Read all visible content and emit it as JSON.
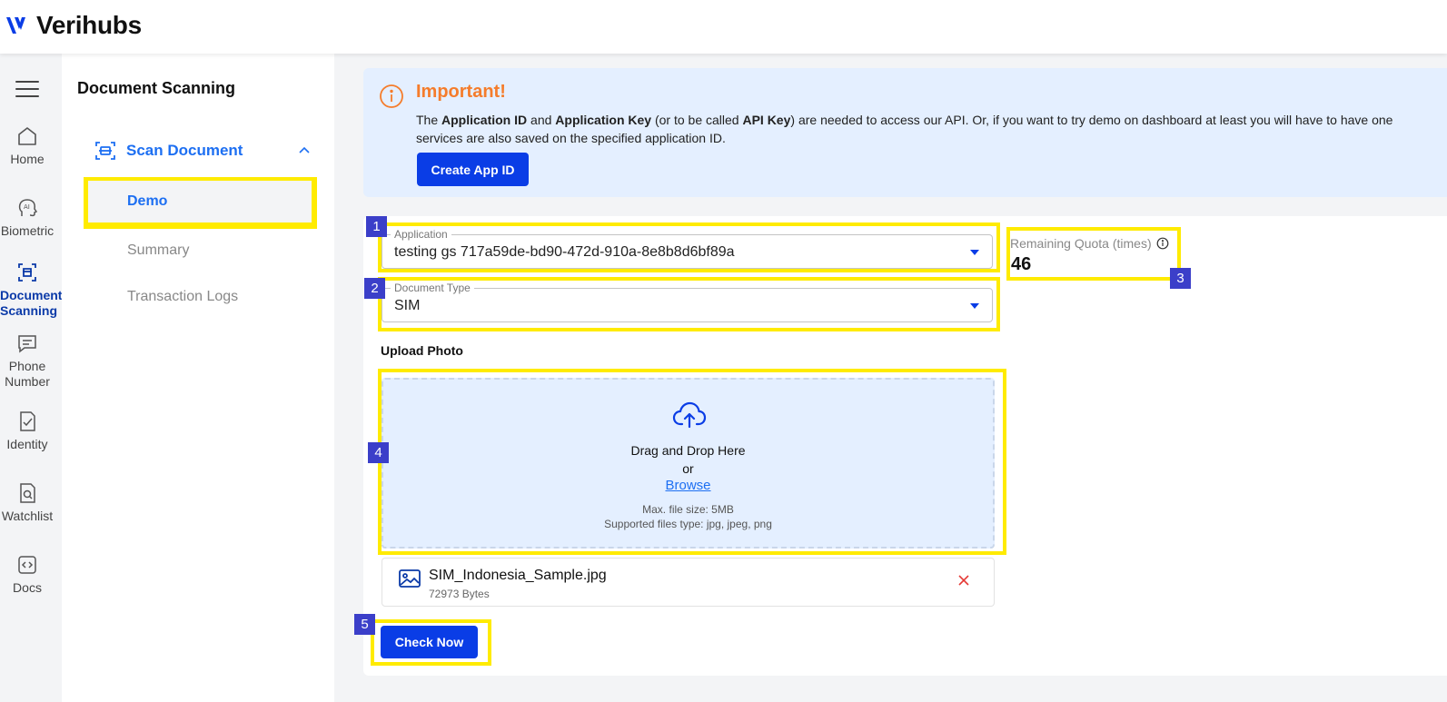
{
  "brand": {
    "name": "Verihubs"
  },
  "rail": {
    "items": [
      {
        "label_lines": [
          "Home"
        ],
        "icon": "home-icon"
      },
      {
        "label_lines": [
          "Biometric"
        ],
        "icon": "ai-head-icon"
      },
      {
        "label_lines": [
          "Document",
          "Scanning"
        ],
        "icon": "scan-document-icon",
        "active": true
      },
      {
        "label_lines": [
          "Phone",
          "Number"
        ],
        "icon": "message-icon"
      },
      {
        "label_lines": [
          "Identity"
        ],
        "icon": "doc-check-icon"
      },
      {
        "label_lines": [
          "Watchlist"
        ],
        "icon": "doc-search-icon"
      },
      {
        "label_lines": [
          "Docs"
        ],
        "icon": "code-icon"
      }
    ]
  },
  "subnav": {
    "title": "Document Scanning",
    "group_label": "Scan Document",
    "items": [
      {
        "label": "Demo",
        "active": true
      },
      {
        "label": "Summary"
      },
      {
        "label": "Transaction Logs"
      }
    ]
  },
  "banner": {
    "title": "Important!",
    "text": {
      "t1": "The ",
      "b1": "Application ID",
      "t2": " and ",
      "b2": "Application Key",
      "t3": " (or to be called ",
      "b3": "API Key",
      "t4": ") are needed to access our API. Or, if you want to try demo on dashboard at least you will have to have one",
      "line2": "services are also saved on the specified application ID."
    },
    "button": "Create App ID"
  },
  "form": {
    "application": {
      "legend": "Application",
      "value": "testing gs 717a59de-bd90-472d-910a-8e8b8d6bf89a"
    },
    "document_type": {
      "legend": "Document Type",
      "value": "SIM"
    },
    "quota": {
      "label": "Remaining Quota (times)",
      "value": "46"
    },
    "upload": {
      "label": "Upload Photo",
      "drag_text": "Drag and Drop Here",
      "or_text": "or",
      "browse": "Browse",
      "max_size": "Max. file size: 5MB",
      "supported": "Supported files type: jpg, jpeg, png"
    },
    "file": {
      "name": "SIM_Indonesia_Sample.jpg",
      "size": "72973 Bytes"
    },
    "submit": "Check Now"
  },
  "annotations": [
    "1",
    "2",
    "3",
    "4",
    "5"
  ],
  "colors": {
    "accent": "#1d6ff2",
    "primary_button": "#0a3de6",
    "warning": "#f57c2b",
    "highlight": "#ffeb00",
    "tag": "#3b3fc9"
  }
}
